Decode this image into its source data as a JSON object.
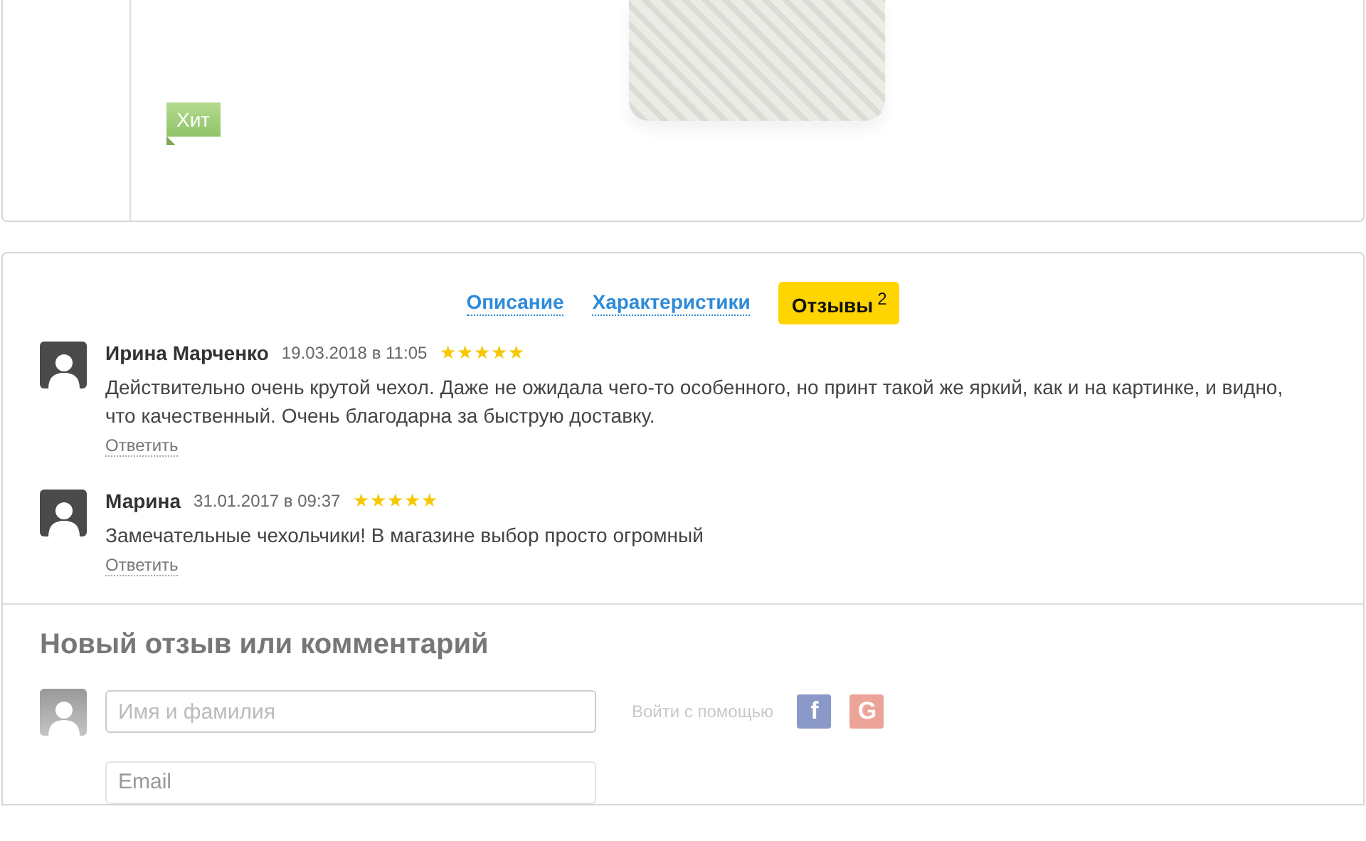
{
  "product": {
    "badge": "Хит"
  },
  "tabs": [
    {
      "label": "Описание",
      "selected": false
    },
    {
      "label": "Характеристики",
      "selected": false
    },
    {
      "label": "Отзывы",
      "count": "2",
      "selected": true
    }
  ],
  "reviews": [
    {
      "author": "Ирина Марченко",
      "date": "19.03.2018 в 11:05",
      "stars": 5,
      "text": "Действительно очень крутой чехол. Даже не ожидала чего-то особенного, но принт такой же яркий, как и на картинке, и видно, что качественный. Очень благодарна за быструю доставку.",
      "reply": "Ответить"
    },
    {
      "author": "Марина",
      "date": "31.01.2017 в 09:37",
      "stars": 5,
      "text": "Замечательные чехольчики! В магазине выбор просто огромный",
      "reply": "Ответить"
    }
  ],
  "form": {
    "title": "Новый отзыв или комментарий",
    "name": {
      "placeholder": "Имя и фамилия"
    },
    "login_label": "Войти с помощью",
    "social": [
      {
        "kind": "facebook",
        "label": "f"
      },
      {
        "kind": "google",
        "label": "G"
      }
    ],
    "email": {
      "placeholder": "Email"
    }
  }
}
